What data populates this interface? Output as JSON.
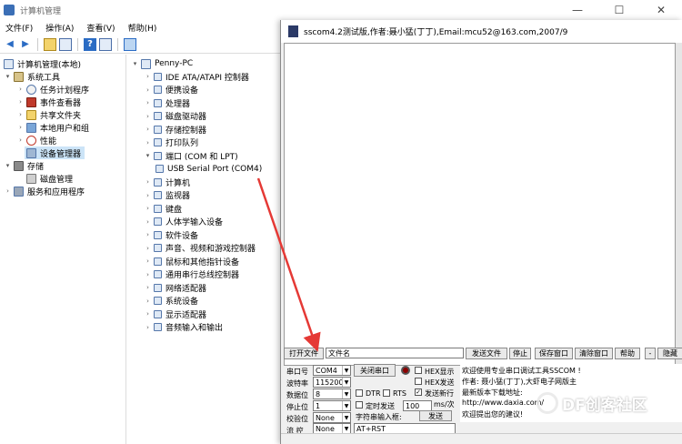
{
  "cm": {
    "title": "计算机管理",
    "menu": [
      "文件(F)",
      "操作(A)",
      "查看(V)",
      "帮助(H)"
    ],
    "win_controls": {
      "minimize": "—",
      "maximize": "☐",
      "close": "✕"
    },
    "left_tree": {
      "root": "计算机管理(本地)",
      "system_tools": "系统工具",
      "task_scheduler": "任务计划程序",
      "event_viewer": "事件查看器",
      "shared_folders": "共享文件夹",
      "local_users": "本地用户和组",
      "performance": "性能",
      "device_manager": "设备管理器",
      "storage": "存储",
      "disk_management": "磁盘管理",
      "services_apps": "服务和应用程序"
    },
    "right_tree": {
      "computer_name": "Penny-PC",
      "items": [
        "IDE ATA/ATAPI 控制器",
        "便携设备",
        "处理器",
        "磁盘驱动器",
        "存储控制器",
        "打印队列",
        "端口 (COM 和 LPT)",
        "USB Serial Port (COM4)",
        "计算机",
        "监视器",
        "键盘",
        "人体学输入设备",
        "软件设备",
        "声音、视频和游戏控制器",
        "鼠标和其他指针设备",
        "通用串行总线控制器",
        "网络适配器",
        "系统设备",
        "显示适配器",
        "音频输入和输出"
      ]
    }
  },
  "ss": {
    "title": "sscom4.2测试版,作者:聂小猛(丁丁),Email:mcu52@163.com,2007/9",
    "open_file": "打开文件",
    "filename_value": "文件名",
    "send_file": "发送文件",
    "stop": "停止",
    "save_window": "保存窗口",
    "clear_window": "清除窗口",
    "help": "帮助",
    "minus": "-",
    "hide": "隐藏",
    "port_label": "串口号",
    "port_value": "COM4",
    "close_port": "关闭串口",
    "baud_label": "波特率",
    "baud_value": "115200",
    "data_label": "数据位",
    "data_value": "8",
    "stop_label": "停止位",
    "stop_value": "1",
    "parity_label": "校验位",
    "parity_value": "None",
    "flow_label": "流 控",
    "flow_value": "None",
    "hex_display": "HEX显示",
    "hex_send": "HEX发送",
    "send_newline": "发送新行",
    "dtr": "DTR",
    "rts": "RTS",
    "timed_send": "定时发送",
    "interval_value": "100",
    "interval_unit": "ms/次",
    "input_label": "字符串输入框:",
    "send_button": "发送",
    "input_value": "AT+RST",
    "info_lines": [
      "欢迎使用专业串口调试工具SSCOM !",
      "作者: 聂小猛(丁丁),大虾电子网版主",
      "最新版本下载地址:",
      "http://www.daxia.com/     ",
      "欢迎提出您的建议!"
    ]
  },
  "watermark": {
    "text": "DF创客社区"
  },
  "colors": {
    "arrow": "#e53935",
    "selection": "#cce4f7",
    "recv_bg": "#ffffff"
  }
}
